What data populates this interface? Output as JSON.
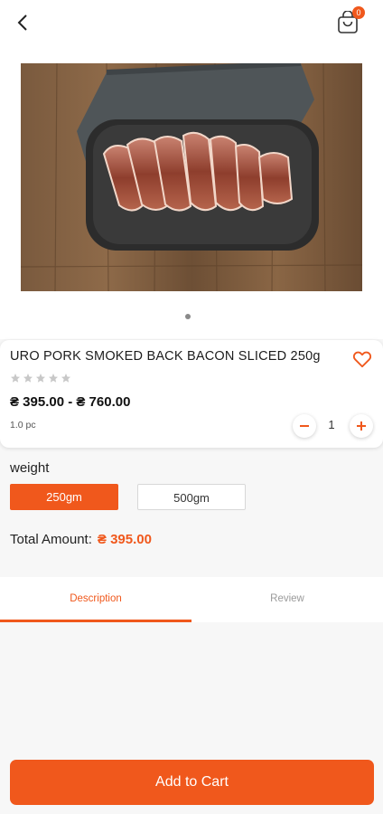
{
  "header": {
    "back_icon": "chevron-left-icon",
    "cart_icon": "shopping-bag-icon",
    "cart_count": "0"
  },
  "gallery": {
    "image_alt": "Smoked back bacon slices on a black platter",
    "active_dot": 1
  },
  "product": {
    "title": "URO PORK SMOKED BACK BACON SLICED 250g",
    "rating": 0,
    "rating_max": 5,
    "price_range": "₴ 395.00 - ₴ 760.00",
    "unit": "1.0 pc",
    "quantity": "1",
    "wishlist_icon": "heart-outline-icon"
  },
  "weight": {
    "label": "weight",
    "options": [
      "250gm",
      "500gm"
    ],
    "selected": "250gm"
  },
  "total": {
    "label": "Total Amount:",
    "value": "₴ 395.00"
  },
  "tabs": [
    {
      "label": "Description",
      "active": true
    },
    {
      "label": "Review",
      "active": false
    }
  ],
  "cta": {
    "label": "Add to Cart"
  },
  "colors": {
    "accent": "#f0581c",
    "background": "#f7f7f7",
    "card": "#ffffff"
  }
}
